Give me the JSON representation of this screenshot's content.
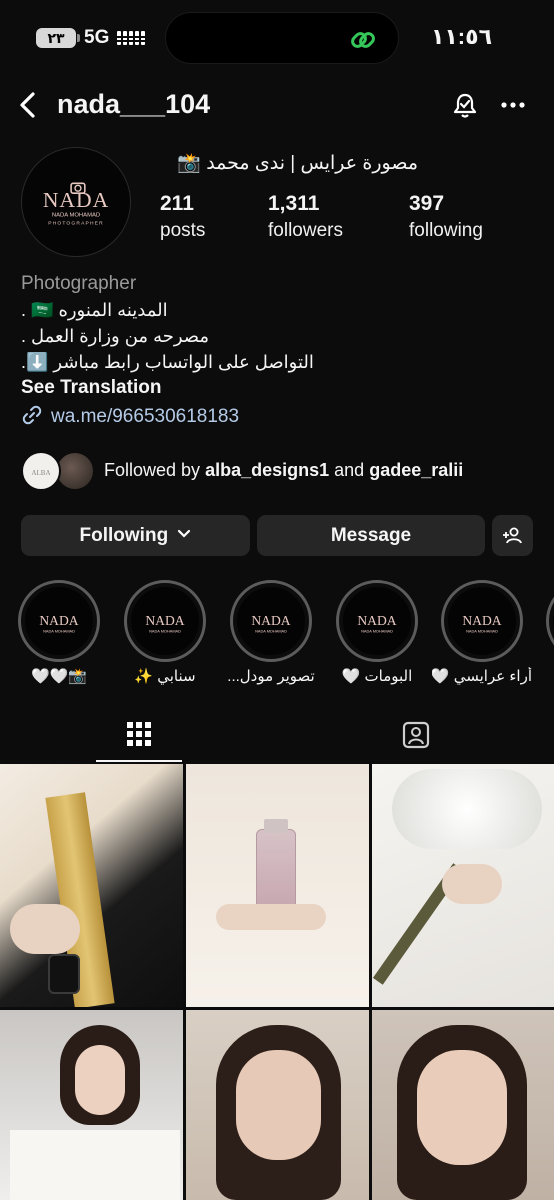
{
  "status_bar": {
    "battery": "٢٣",
    "network": "5G",
    "time": "١١:٥٦"
  },
  "header": {
    "username": "nada___104",
    "back_icon": "chevron-left-icon",
    "notify_icon": "bell-icon",
    "more_icon": "more-icon"
  },
  "profile": {
    "display_name": "مصورة عرايس | ندى محمد 📸",
    "logo_name": "NADA",
    "logo_sub": "NADA MOHAMAD",
    "logo_role": "PHOTOGRAPHER",
    "stats": [
      {
        "num": "211",
        "label": "posts"
      },
      {
        "num": "1,311",
        "label": "followers"
      },
      {
        "num": "397",
        "label": "following"
      }
    ],
    "category": "Photographer",
    "bio": [
      "المدينه المنوره 🇸🇦 .",
      "مصرحه من وزارة العمل .",
      "التواصل على الواتساب رابط مباشر ⬇️."
    ],
    "see_translation": "See Translation",
    "link": "wa.me/966530618183"
  },
  "followed_by": {
    "prefix": "Followed by",
    "user1": "alba_designs1",
    "and": "and",
    "user2": "gadee_ralii"
  },
  "buttons": {
    "following": "Following",
    "message": "Message"
  },
  "highlights": [
    {
      "caption": "📸🤍🤍"
    },
    {
      "caption": "سنابي ✨"
    },
    {
      "caption": "تصوير مودل..."
    },
    {
      "caption": "البومات 🤍"
    },
    {
      "caption": "أراء عرايسي 🤍 ."
    },
    {
      "caption": "..."
    }
  ],
  "tabs": [
    {
      "icon": "grid-icon",
      "active": true
    },
    {
      "icon": "tagged-icon",
      "active": false
    }
  ],
  "colors": {
    "background": "#0c0c0c",
    "button": "#262626",
    "link": "#b4cbe8",
    "ring": "#5c5c5c"
  }
}
